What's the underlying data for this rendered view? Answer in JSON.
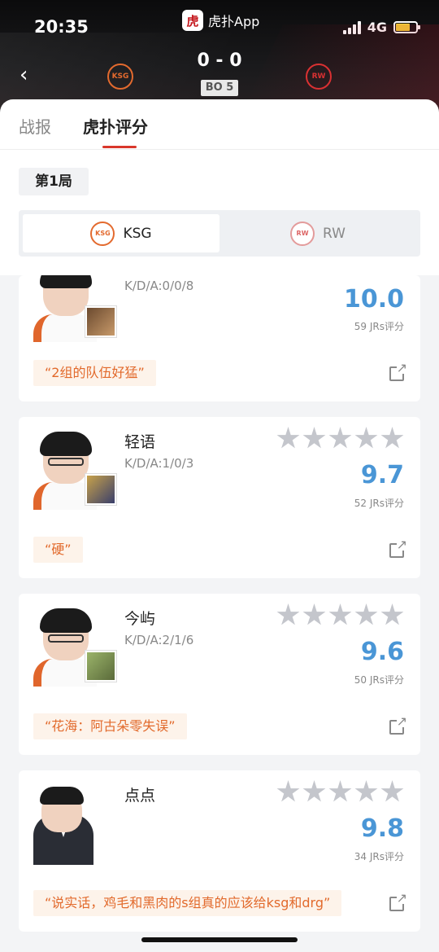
{
  "status_bar": {
    "time": "20:35",
    "app_name": "虎扑App",
    "app_logo_char": "虎",
    "network": "4G"
  },
  "match": {
    "score": "0 - 0",
    "format": "BO 5",
    "home_logo_text": "KSG",
    "away_logo_text": "RW"
  },
  "tabs": [
    {
      "label": "战报"
    },
    {
      "label": "虎扑评分"
    }
  ],
  "game_chip": "第1局",
  "teams": [
    {
      "name": "KSG",
      "logo_text": "KSG"
    },
    {
      "name": "RW",
      "logo_text": "RW"
    }
  ],
  "players": [
    {
      "name": "",
      "kda": "K/D/A:0/0/8",
      "rating": "10.0",
      "jrs": "59 JRs评分",
      "quote": "“2组的队伍好猛”"
    },
    {
      "name": "轻语",
      "kda": "K/D/A:1/0/3",
      "rating": "9.7",
      "jrs": "52 JRs评分",
      "quote": "“硬”"
    },
    {
      "name": "今屿",
      "kda": "K/D/A:2/1/6",
      "rating": "9.6",
      "jrs": "50 JRs评分",
      "quote": "“花海：阿古朵零失误”"
    },
    {
      "name": "点点",
      "kda": "",
      "rating": "9.8",
      "jrs": "34 JRs评分",
      "quote": "“说实话，鸡毛和黑肉的s组真的应该给ksg和drg”"
    }
  ],
  "colors": {
    "accent_red": "#d9372b",
    "rating_blue": "#4a96d6",
    "quote_orange": "#e26a2c"
  }
}
